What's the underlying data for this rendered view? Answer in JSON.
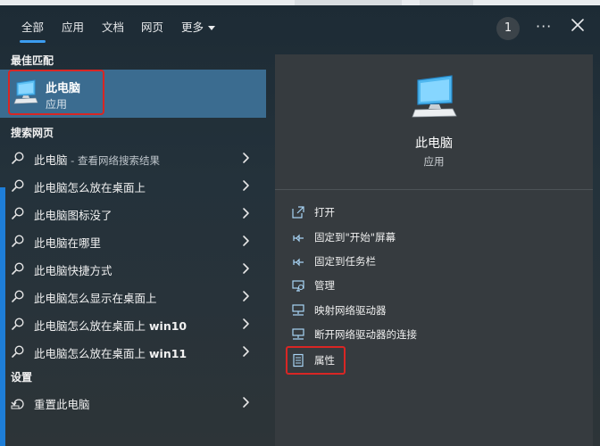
{
  "tabs": {
    "all": "全部",
    "apps": "应用",
    "docs": "文档",
    "web": "网页",
    "more": "更多",
    "count": "1",
    "ellipsis": "···"
  },
  "left": {
    "best_match_heading": "最佳匹配",
    "best_match": {
      "title": "此电脑",
      "subtitle": "应用"
    },
    "web_heading": "搜索网页",
    "web_items": [
      {
        "label": "此电脑",
        "suffix": " - 查看网络搜索结果"
      },
      {
        "label": "此电脑怎么放在桌面上",
        "suffix": ""
      },
      {
        "label": "此电脑图标没了",
        "suffix": ""
      },
      {
        "label": "此电脑在哪里",
        "suffix": ""
      },
      {
        "label": "此电脑快捷方式",
        "suffix": ""
      },
      {
        "label": "此电脑怎么显示在桌面上",
        "suffix": ""
      },
      {
        "label": "此电脑怎么放在桌面上 ",
        "bold": "win10"
      },
      {
        "label": "此电脑怎么放在桌面上 ",
        "bold": "win11"
      }
    ],
    "settings_heading": "设置",
    "settings_item": "重置此电脑"
  },
  "right": {
    "title": "此电脑",
    "subtitle": "应用",
    "actions": [
      {
        "label": "打开",
        "icon": "open-icon"
      },
      {
        "label": "固定到\"开始\"屏幕",
        "icon": "pin-icon"
      },
      {
        "label": "固定到任务栏",
        "icon": "pin-icon"
      },
      {
        "label": "管理",
        "icon": "manage-icon"
      },
      {
        "label": "映射网络驱动器",
        "icon": "network-drive-icon"
      },
      {
        "label": "断开网络驱动器的连接",
        "icon": "network-drive-icon"
      },
      {
        "label": "属性",
        "icon": "properties-icon"
      }
    ]
  },
  "colors": {
    "accent": "#3b9cf0",
    "selection": "#3b6c90",
    "highlight_box": "#d92624"
  }
}
